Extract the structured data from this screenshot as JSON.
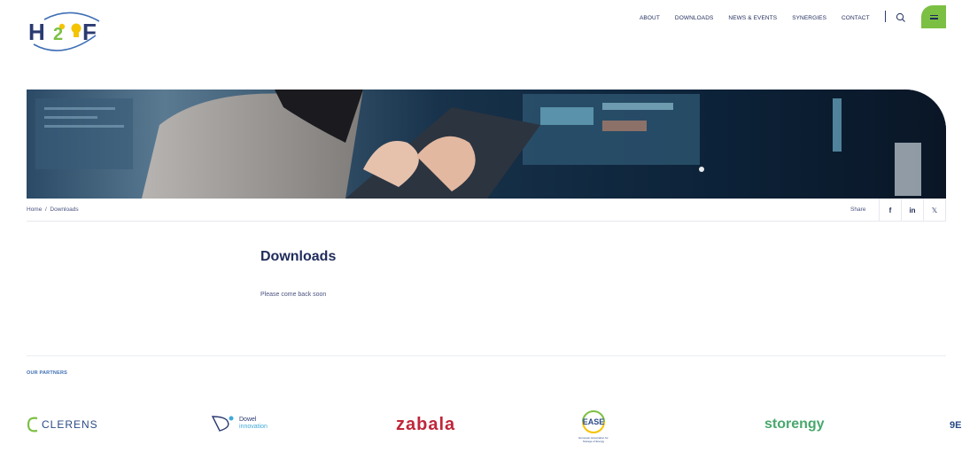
{
  "brand": {
    "logo_text": "H2F"
  },
  "nav": {
    "items": [
      "ABOUT",
      "DOWNLOADS",
      "NEWS & EVENTS",
      "SYNERGIES",
      "CONTACT"
    ]
  },
  "breadcrumb": {
    "home": "Home",
    "separator": "/",
    "current": "Downloads"
  },
  "share": {
    "label": "Share",
    "facebook": "f",
    "linkedin": "in",
    "x": "𝕏"
  },
  "main": {
    "title": "Downloads",
    "text": "Please come back soon"
  },
  "partners": {
    "title": "OUR PARTNERS",
    "clerens": "CLERENS",
    "dowel_line1": "Dowel",
    "dowel_line2": "innovation",
    "zabala": "zabala",
    "ease": "EASE",
    "ease_sub": "European Association for Storage of Energy",
    "storengy": "storengy",
    "more": "9E"
  },
  "colors": {
    "accent_green": "#7cc043",
    "navy": "#1f2b5b",
    "partner_blue": "#3f6fb5"
  }
}
